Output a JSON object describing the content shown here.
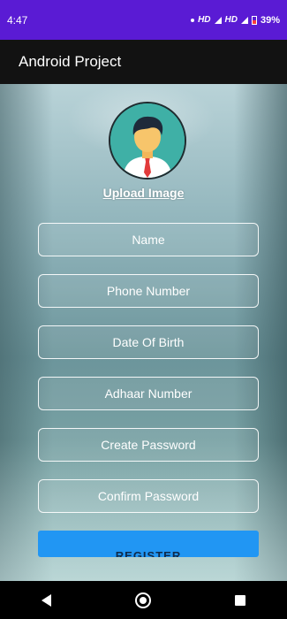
{
  "status_bar": {
    "time": "4:47",
    "network_label": "HD",
    "network_label_2": "HD",
    "battery_percent": "39%"
  },
  "app_bar": {
    "title": "Android Project"
  },
  "form": {
    "upload_label": "Upload Image",
    "fields": [
      {
        "placeholder": "Name"
      },
      {
        "placeholder": "Phone Number"
      },
      {
        "placeholder": "Date Of Birth"
      },
      {
        "placeholder": "Adhaar Number"
      },
      {
        "placeholder": "Create Password"
      },
      {
        "placeholder": "Confirm Password"
      }
    ],
    "register_label": "REGISTER"
  },
  "colors": {
    "status_bar": "#5a1bd4",
    "app_bar": "#121212",
    "register_button": "#2196f3"
  }
}
